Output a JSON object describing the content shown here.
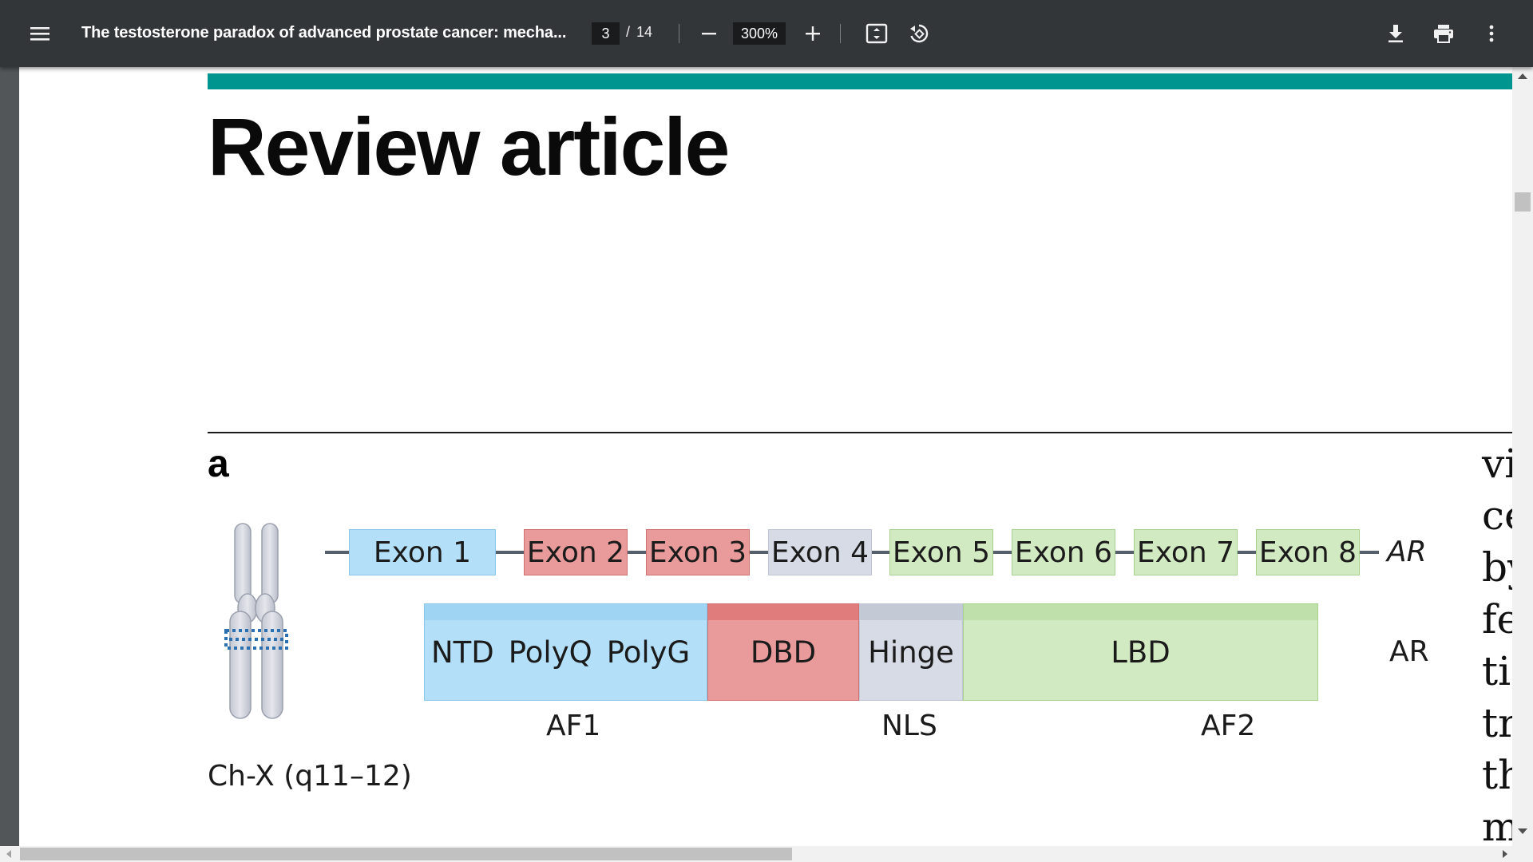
{
  "toolbar": {
    "menu_icon": "hamburger-menu-icon",
    "title": "The testosterone paradox of advanced prostate cancer: mecha...",
    "page_current": "3",
    "page_separator": "/",
    "page_total": "14",
    "zoom": "300%",
    "icons": {
      "zoom_out": "minus-icon",
      "zoom_in": "plus-icon",
      "fit": "fit-to-page-icon",
      "rotate": "rotate-counterclockwise-icon",
      "download": "download-icon",
      "print": "print-icon",
      "more": "more-vertical-icon"
    }
  },
  "page": {
    "article_type": "Review article",
    "panel_label": "a",
    "chromosome_label": "Ch-X (q11–12)",
    "gene": {
      "exons": [
        "Exon 1",
        "Exon 2",
        "Exon 3",
        "Exon 4",
        "Exon 5",
        "Exon 6",
        "Exon 7",
        "Exon 8"
      ],
      "label": "AR"
    },
    "protein": {
      "ntd_labels": [
        "NTD",
        "PolyQ",
        "PolyG"
      ],
      "dbd": "DBD",
      "hinge": "Hinge",
      "lbd": "LBD",
      "label": "AR",
      "below": {
        "af1": "AF1",
        "nls": "NLS",
        "af2": "AF2"
      }
    },
    "right_column_fragments": [
      "vi",
      "ce",
      "by",
      "fe",
      "ti",
      "tr",
      "th",
      "m"
    ]
  },
  "colors": {
    "toolbar_bg": "#323639",
    "viewer_bg": "#525659",
    "teal_bar": "#00968f",
    "exon_blue": "#b3e0f8",
    "exon_red": "#e99a9a",
    "exon_gray": "#d7dbe5",
    "exon_green": "#d2eac1"
  }
}
